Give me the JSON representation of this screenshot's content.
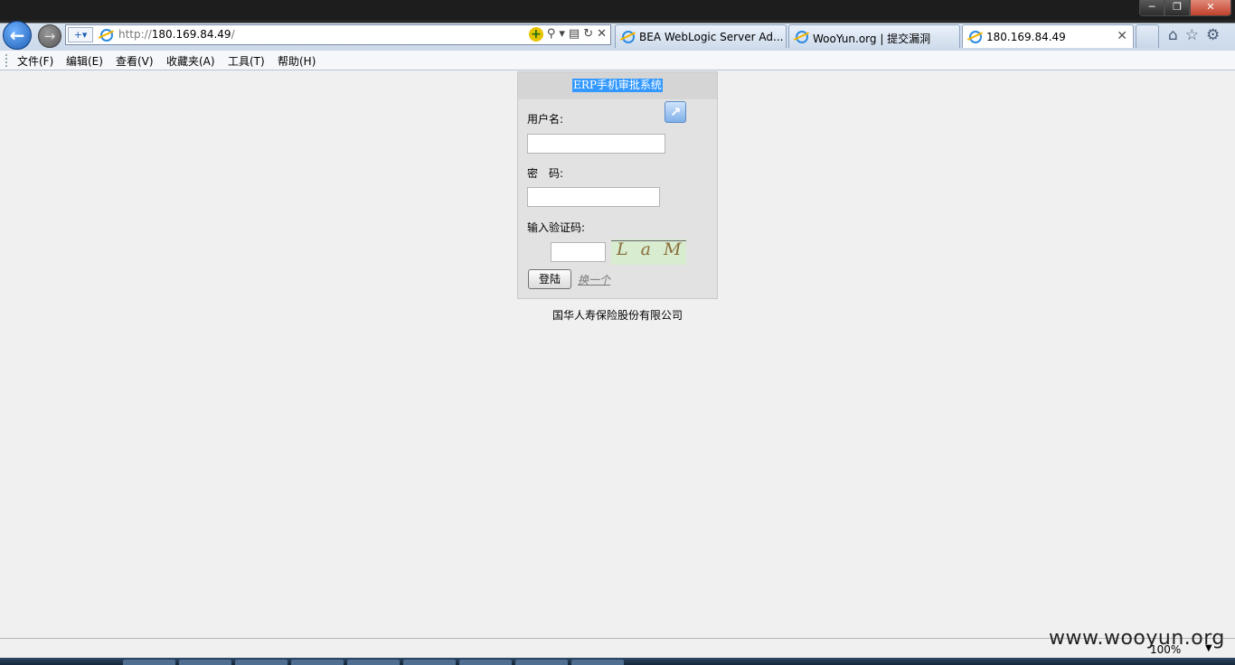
{
  "browser": {
    "address": {
      "protocol": "http://",
      "host": "180.169.84.49",
      "path": "/"
    },
    "tabs": [
      {
        "label": "BEA WebLogic Server Ad..."
      },
      {
        "label": "WooYun.org | 提交漏洞"
      },
      {
        "label": "180.169.84.49"
      }
    ],
    "window_buttons": {
      "minimize": "─",
      "maximize": "❐",
      "close": "✕"
    },
    "icons": [
      "back-icon",
      "forward-icon",
      "compat-view-icon",
      "ie-icon",
      "search-icon",
      "refresh-icon",
      "stop-icon",
      "home-icon",
      "favorites-star-icon",
      "gear-icon"
    ]
  },
  "menu": [
    {
      "label": "文件(F)"
    },
    {
      "label": "编辑(E)"
    },
    {
      "label": "查看(V)"
    },
    {
      "label": "收藏夹(A)"
    },
    {
      "label": "工具(T)"
    },
    {
      "label": "帮助(H)"
    }
  ],
  "login": {
    "title": "ERP手机审批系统",
    "username_label": "用户名:",
    "username_value": "",
    "password_label": "密　码:",
    "password_value": "",
    "captcha_label": "输入验证码:",
    "captcha_value": "",
    "captcha_text": "L a M",
    "login_button": "登陆",
    "change_link": "换一个",
    "colors": {
      "title_highlight": "#3399ff",
      "panel_bg": "#e2e2e2",
      "header_bg": "#d5d5d5"
    }
  },
  "footer": {
    "company": "国华人寿保险股份有限公司"
  },
  "statusbar": {
    "zoom": "100%"
  },
  "watermark": "www.wooyun.org"
}
